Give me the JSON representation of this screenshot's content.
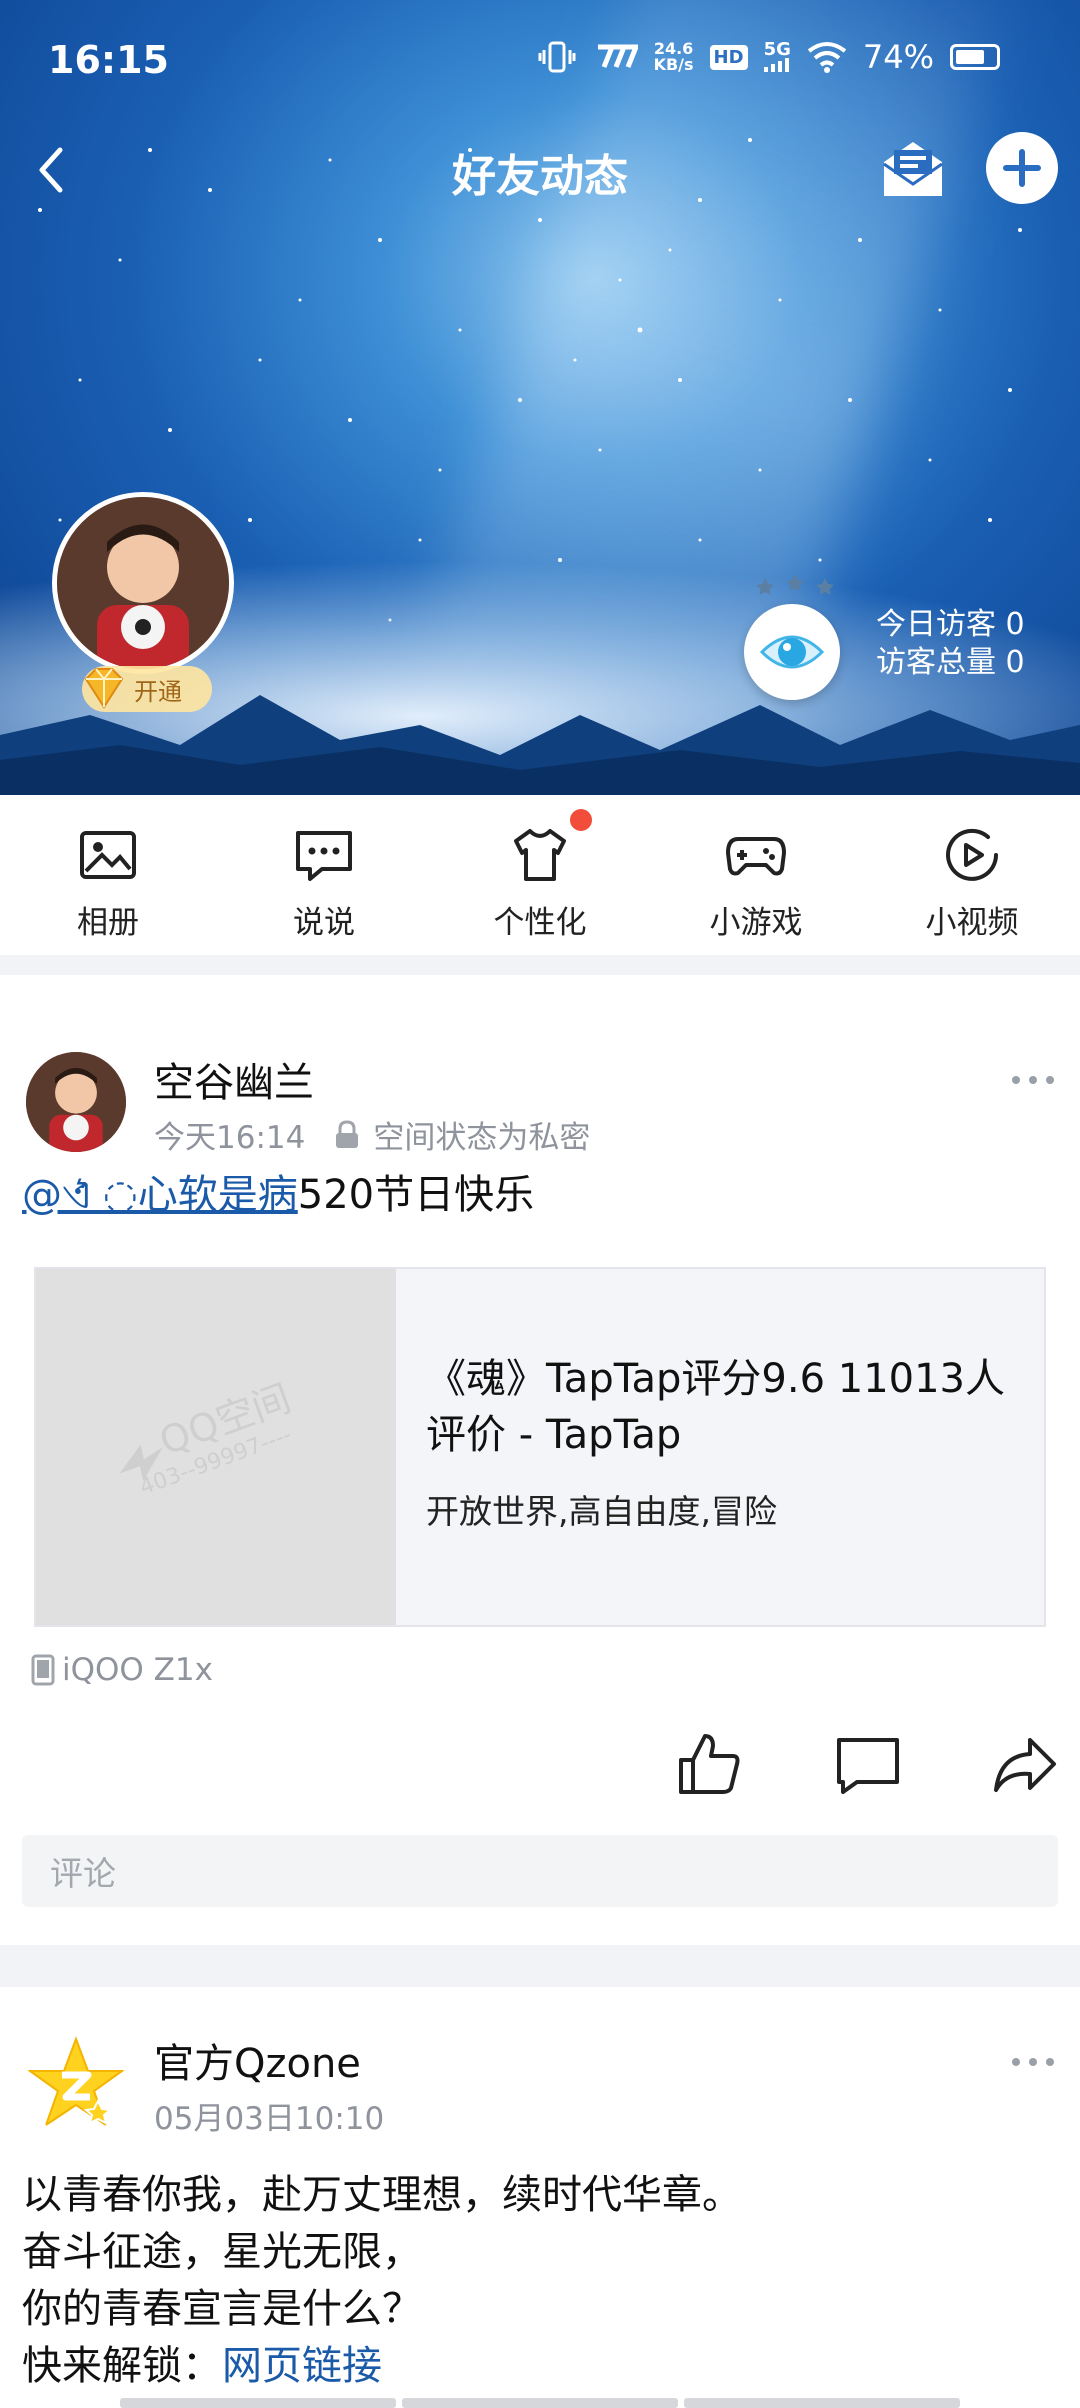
{
  "status_bar": {
    "time": "16:15",
    "net_speed_value": "24.6",
    "net_speed_unit": "KB/s",
    "network": "5G",
    "hd": "HD",
    "battery": "74%",
    "battery_level": 0.74
  },
  "nav": {
    "title": "好友动态"
  },
  "profile": {
    "vip_label": "开通",
    "visitors_today_label": "今日访客",
    "visitors_today": "0",
    "visitors_total_label": "访客总量",
    "visitors_total": "0"
  },
  "toolbar": [
    {
      "label": "相册",
      "icon": "photo-icon"
    },
    {
      "label": "说说",
      "icon": "chat-bubble-icon"
    },
    {
      "label": "个性化",
      "icon": "tshirt-icon",
      "has_badge": true
    },
    {
      "label": "小游戏",
      "icon": "gamepad-icon"
    },
    {
      "label": "小视频",
      "icon": "video-play-icon"
    }
  ],
  "posts": [
    {
      "author": "空谷幽兰",
      "time": "今天16:14",
      "privacy": "空间状态为私密",
      "mention": "@ଏ͛ ◌心软是病",
      "text": "520节日快乐",
      "link_card": {
        "title": "《魂》TapTap评分9.6  11013人评价 - TapTap",
        "desc": "开放世界,高自由度,冒险",
        "watermark_brand": "QQ空间",
        "watermark_num": "403--99997----"
      },
      "device": "iQOO  Z1x",
      "comment_placeholder": "评论"
    },
    {
      "author": "官方Qzone",
      "time": "05月03日10:10",
      "lines": [
        "以青春你我，赴万丈理想，续时代华章。",
        "奋斗征途，星光无限，",
        "你的青春宣言是什么？"
      ],
      "unlock_prefix": "快来解锁：",
      "unlock_link": "网页链接"
    }
  ],
  "colors": {
    "accent": "#1a5aa8",
    "badge_red": "#f24d3b",
    "meta_gray": "#8e939c"
  }
}
